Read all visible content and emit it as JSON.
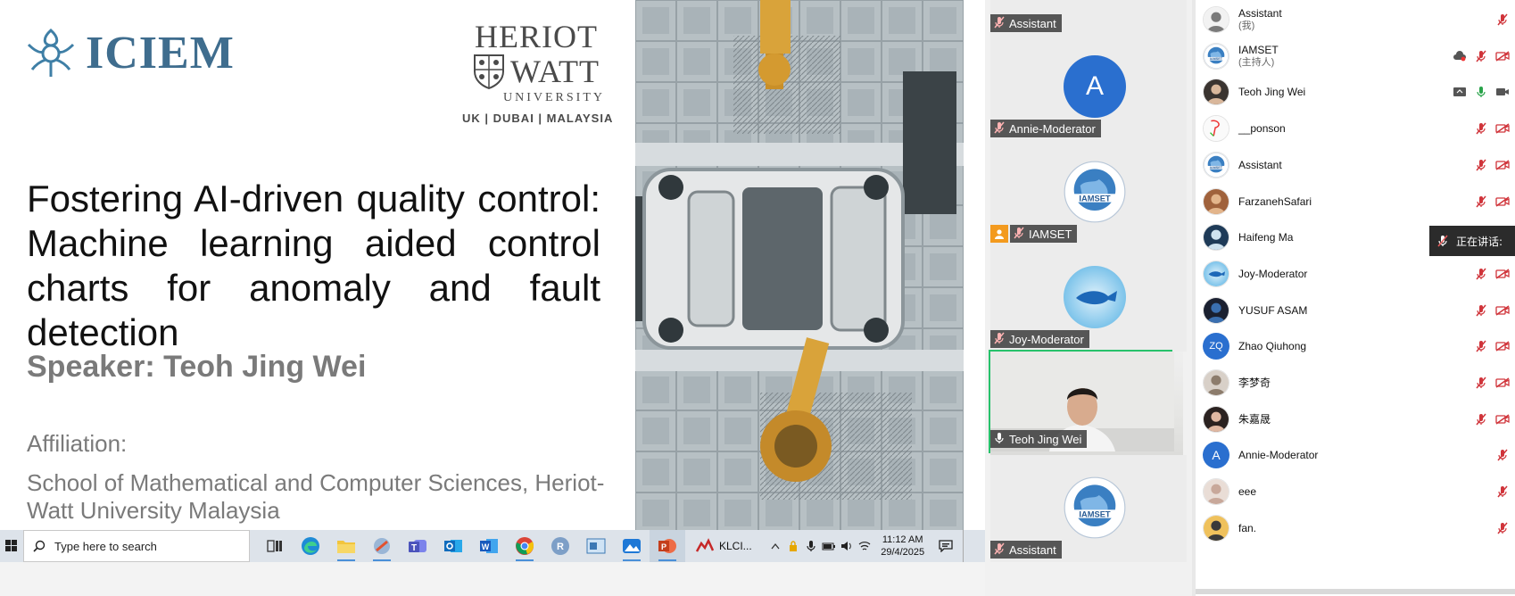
{
  "slide": {
    "logo_left": "ICIEM",
    "logo_right_line1": "HERIOT",
    "logo_right_line2": "WATT",
    "logo_right_line3": "UNIVERSITY",
    "logo_right_locations": "UK | DUBAI | MALAYSIA",
    "title": "Fostering AI-driven quality control: Machine learning aided control charts for anomaly and fault detection",
    "speaker": "Speaker: Teoh Jing Wei",
    "affiliation_label": "Affiliation:",
    "affiliation": "School of Mathematical and Computer Sciences, Heriot-Watt University Malaysia"
  },
  "taskbar": {
    "search_placeholder": "Type here to search",
    "apps": [
      "task-view",
      "edge",
      "file-explorer",
      "snipping-tool",
      "teams",
      "outlook",
      "word",
      "chrome",
      "r",
      "app-generic",
      "photos",
      "powerpoint"
    ],
    "klci_label": "KLCI...",
    "time": "11:12 AM",
    "date": "29/4/2025"
  },
  "gallery": {
    "tiles": [
      {
        "name": "Assistant",
        "avatar": "",
        "muted": true
      },
      {
        "name": "Annie-Moderator",
        "avatar": "A",
        "muted": true,
        "color": "#2a6fcf"
      },
      {
        "name": "IAMSET",
        "avatar": "logo",
        "muted": true,
        "host": true
      },
      {
        "name": "Joy-Moderator",
        "avatar": "fish",
        "muted": true
      },
      {
        "name": "Teoh Jing Wei",
        "avatar": "video",
        "muted": false,
        "active": true
      },
      {
        "name": "Assistant",
        "avatar": "logo",
        "muted": true
      }
    ],
    "logo_text": "IAMSET"
  },
  "participants": [
    {
      "name": "Assistant",
      "sub": "(我)",
      "avatar": "assistant",
      "mic": "muted",
      "cam": ""
    },
    {
      "name": "IAMSET",
      "sub": "(主持人)",
      "avatar": "logo",
      "mic": "muted",
      "cam": "off",
      "extra": "cloud"
    },
    {
      "name": "Teoh Jing Wei",
      "sub": "",
      "avatar": "photo-man",
      "mic": "on",
      "cam": "on",
      "extra": "share"
    },
    {
      "name": "__ponson",
      "sub": "",
      "avatar": "ponson",
      "mic": "muted",
      "cam": "off"
    },
    {
      "name": "Assistant",
      "sub": "",
      "avatar": "logo",
      "mic": "muted",
      "cam": "off"
    },
    {
      "name": "FarzanehSafari",
      "sub": "",
      "avatar": "photo-warm",
      "mic": "muted",
      "cam": "off"
    },
    {
      "name": "Haifeng Ma",
      "sub": "",
      "avatar": "photo-blue",
      "mic": "",
      "cam": ""
    },
    {
      "name": "Joy-Moderator",
      "sub": "",
      "avatar": "fish",
      "mic": "muted",
      "cam": "off"
    },
    {
      "name": "YUSUF ASAM",
      "sub": "",
      "avatar": "photo-dark",
      "mic": "muted",
      "cam": "off"
    },
    {
      "name": "Zhao Qiuhong",
      "sub": "",
      "avatar": "ZQ",
      "mic": "muted",
      "cam": "off"
    },
    {
      "name": "李梦奇",
      "sub": "",
      "avatar": "photo-light",
      "mic": "muted",
      "cam": "off"
    },
    {
      "name": "朱嘉晟",
      "sub": "",
      "avatar": "photo-girl",
      "mic": "muted",
      "cam": "off"
    },
    {
      "name": "Annie-Moderator",
      "sub": "",
      "avatar": "A",
      "mic": "muted",
      "cam": ""
    },
    {
      "name": "eee",
      "sub": "",
      "avatar": "photo-pale",
      "mic": "muted",
      "cam": ""
    },
    {
      "name": "fan.",
      "sub": "",
      "avatar": "photo-sky",
      "mic": "muted",
      "cam": ""
    }
  ],
  "speaking_popup": "正在讲话:",
  "colors": {
    "accent_blue": "#2a6fcf",
    "active_green": "#27c26b",
    "muted_red": "#d0343a",
    "host_orange": "#f39a1e"
  }
}
